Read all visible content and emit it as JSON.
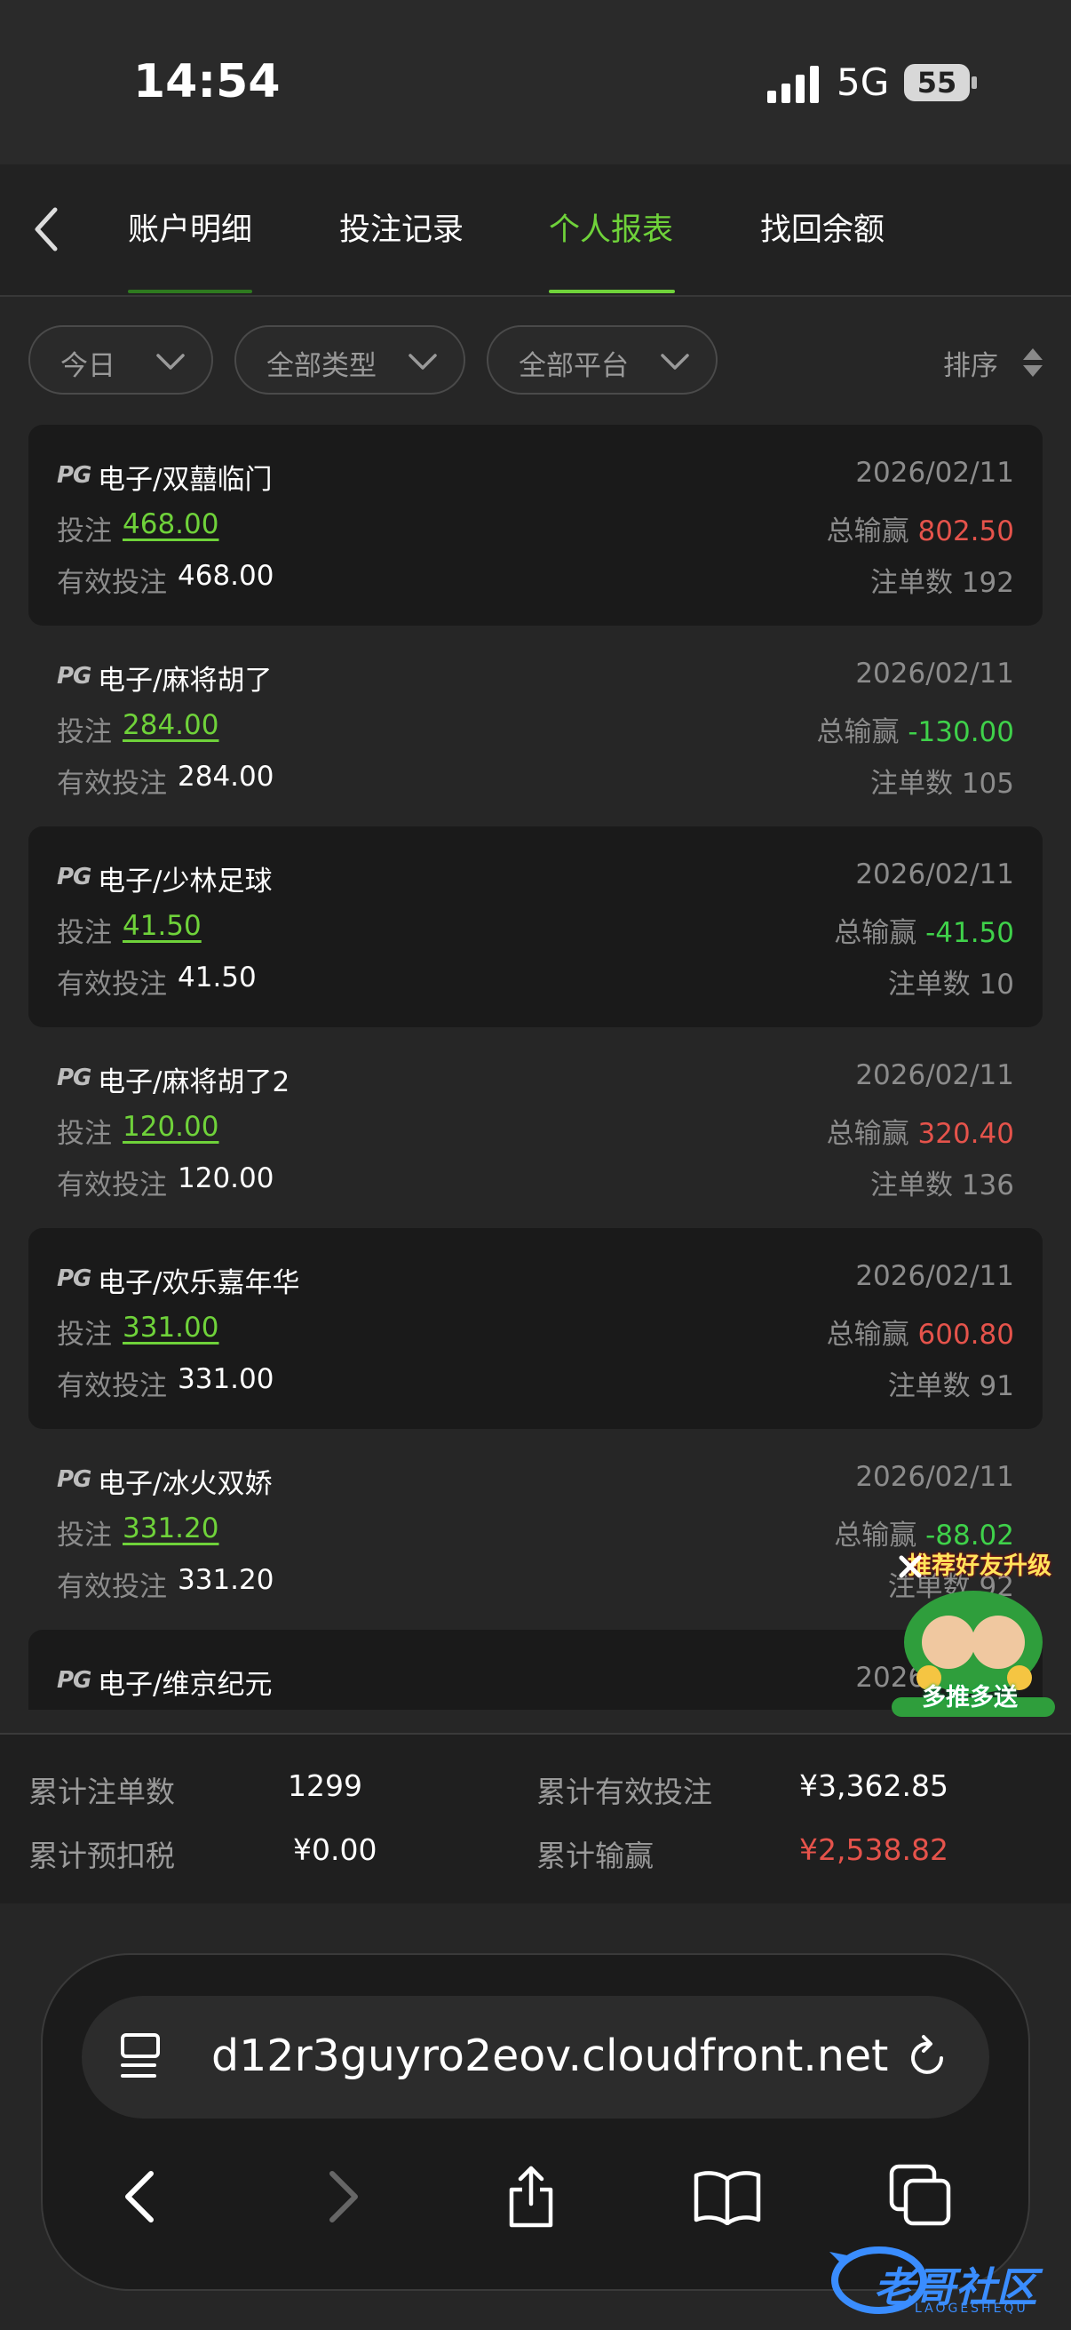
{
  "status": {
    "time": "14:54",
    "network": "5G",
    "battery": "55"
  },
  "tabs": [
    {
      "label": "账户明细",
      "active": false
    },
    {
      "label": "投注记录",
      "active": false
    },
    {
      "label": "个人报表",
      "active": true
    },
    {
      "label": "找回余额",
      "active": false
    }
  ],
  "filters": {
    "date": "今日",
    "type": "全部类型",
    "platform": "全部平台",
    "sort": "排序"
  },
  "labels": {
    "bet": "投注",
    "valid_bet": "有效投注",
    "win": "总输赢",
    "count": "注单数",
    "provider": "PG"
  },
  "records": [
    {
      "game": "电子/双囍临门",
      "date": "2026/02/11",
      "bet": "468.00",
      "valid": "468.00",
      "win": "802.50",
      "count": "192",
      "status": "positive"
    },
    {
      "game": "电子/麻将胡了",
      "date": "2026/02/11",
      "bet": "284.00",
      "valid": "284.00",
      "win": "-130.00",
      "count": "105",
      "status": "negative"
    },
    {
      "game": "电子/少林足球",
      "date": "2026/02/11",
      "bet": "41.50",
      "valid": "41.50",
      "win": "-41.50",
      "count": "10",
      "status": "negative"
    },
    {
      "game": "电子/麻将胡了2",
      "date": "2026/02/11",
      "bet": "120.00",
      "valid": "120.00",
      "win": "320.40",
      "count": "136",
      "status": "positive"
    },
    {
      "game": "电子/欢乐嘉年华",
      "date": "2026/02/11",
      "bet": "331.00",
      "valid": "331.00",
      "win": "600.80",
      "count": "91",
      "status": "positive"
    },
    {
      "game": "电子/冰火双娇",
      "date": "2026/02/11",
      "bet": "331.20",
      "valid": "331.20",
      "win": "-88.02",
      "count": "92",
      "status": "negative"
    },
    {
      "game": "电子/维京纪元",
      "date": "2026/02/11"
    }
  ],
  "summary": {
    "total_count_label": "累计注单数",
    "total_count": "1299",
    "total_valid_label": "累计有效投注",
    "total_valid": "¥3,362.85",
    "tax_label": "累计预扣税",
    "tax": "¥0.00",
    "total_win_label": "累计输赢",
    "total_win": "¥2,538.82"
  },
  "promo": {
    "top": "推荐好友升级",
    "bottom": "多推多送"
  },
  "browser": {
    "url": "d12r3guyro2eov.cloudfront.net"
  },
  "watermark": {
    "text": "老哥社区",
    "sub": "LAOGESHEQU"
  },
  "colors": {
    "accent": "#6fd23a",
    "positive": "#e5534b",
    "negative": "#3fd14a"
  }
}
